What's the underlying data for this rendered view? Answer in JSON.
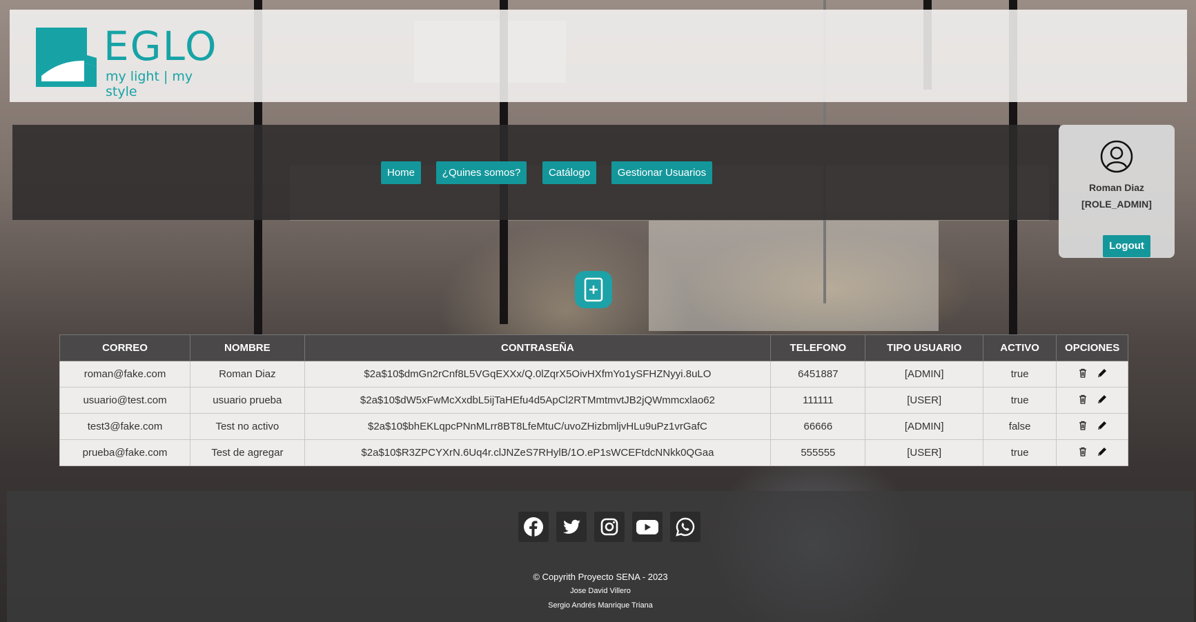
{
  "brand": {
    "name": "EGLO",
    "tagline": "my light | my style",
    "color": "#17a3a6"
  },
  "nav": {
    "items": [
      {
        "label": "Home"
      },
      {
        "label": "¿Quines somos?"
      },
      {
        "label": "Catálogo"
      },
      {
        "label": "Gestionar Usuarios"
      }
    ]
  },
  "user": {
    "name": "Roman Diaz",
    "role": "[ROLE_ADMIN]",
    "logout_label": "Logout",
    "avatar_icon": "user-circle-icon"
  },
  "actions": {
    "add_icon": "add-document-icon"
  },
  "table": {
    "headers": [
      "CORREO",
      "NOMBRE",
      "CONTRASEÑA",
      "TELEFONO",
      "TIPO USUARIO",
      "ACTIVO",
      "OPCIONES"
    ],
    "rows": [
      {
        "correo": "roman@fake.com",
        "nombre": "Roman Diaz",
        "password": "$2a$10$dmGn2rCnf8L5VGqEXXx/Q.0lZqrX5OivHXfmYo1ySFHZNyyi.8uLO",
        "telefono": "6451887",
        "tipo": "[ADMIN]",
        "activo": "true"
      },
      {
        "correo": "usuario@test.com",
        "nombre": "usuario prueba",
        "password": "$2a$10$dW5xFwMcXxdbL5ijTaHEfu4d5ApCl2RTMmtmvtJB2jQWmmcxlao62",
        "telefono": "111111",
        "tipo": "[USER]",
        "activo": "true"
      },
      {
        "correo": "test3@fake.com",
        "nombre": "Test no activo",
        "password": "$2a$10$bhEKLqpcPNnMLrr8BT8LfeMtuC/uvoZHizbmljvHLu9uPz1vrGafC",
        "telefono": "66666",
        "tipo": "[ADMIN]",
        "activo": "false"
      },
      {
        "correo": "prueba@fake.com",
        "nombre": "Test de agregar",
        "password": "$2a$10$R3ZPCYXrN.6Uq4r.clJNZeS7RHylB/1O.eP1sWCEFtdcNNkk0QGaa",
        "telefono": "555555",
        "tipo": "[USER]",
        "activo": "true"
      }
    ],
    "option_icons": [
      "trash-icon",
      "pencil-icon"
    ]
  },
  "footer": {
    "social": [
      "facebook-icon",
      "twitter-icon",
      "instagram-icon",
      "youtube-icon",
      "whatsapp-icon"
    ],
    "copyright": "© Copyrith Proyecto SENA - 2023",
    "author1": "Jose David Villero",
    "author2": "Sergio Andrés Manrique Triana"
  }
}
